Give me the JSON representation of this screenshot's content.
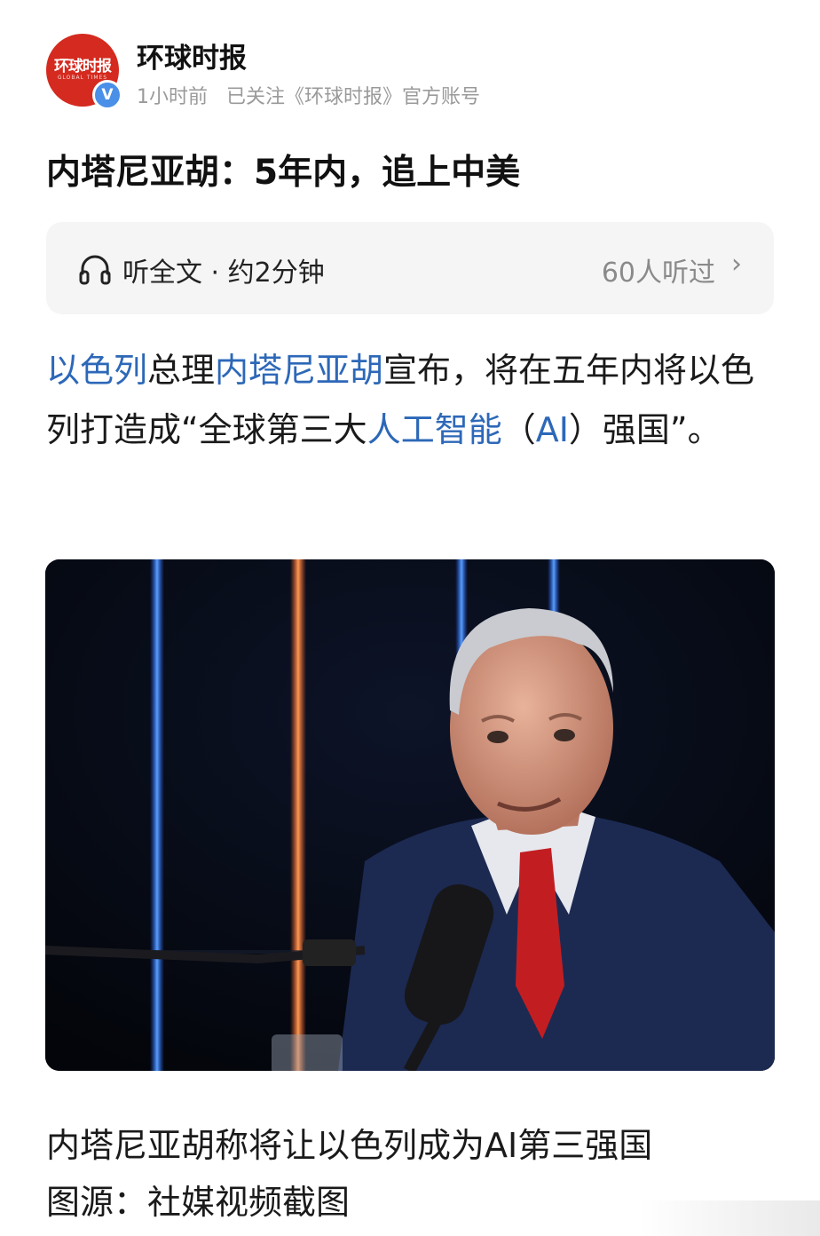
{
  "header": {
    "logo_text": "环球时报",
    "logo_sub": "GLOBAL TIMES",
    "verified_mark": "V",
    "source_name": "环球时报",
    "time": "1小时前",
    "follow_info": "已关注《环球时报》官方账号"
  },
  "article": {
    "title": "内塔尼亚胡：5年内，追上中美",
    "listen": {
      "icon": "headphones-icon",
      "label": "听全文 · 约2分钟",
      "count": "60人听过",
      "chevron": "›"
    },
    "paragraph": {
      "link1": "以色列",
      "text1": "总理",
      "link2": "内塔尼亚胡",
      "text2": "宣布，将在五年内将以色列打造成“全球第三大",
      "link3": "人工智能",
      "text3": "（",
      "link4": "AI",
      "text4": "）强国”。"
    },
    "image_caption": "内塔尼亚胡称将让以色列成为AI第三强国",
    "image_credit": "图源：社媒视频截图"
  },
  "colors": {
    "link": "#2d68b8",
    "brand_red": "#d42a1f",
    "verified_blue": "#4a8fe8"
  }
}
